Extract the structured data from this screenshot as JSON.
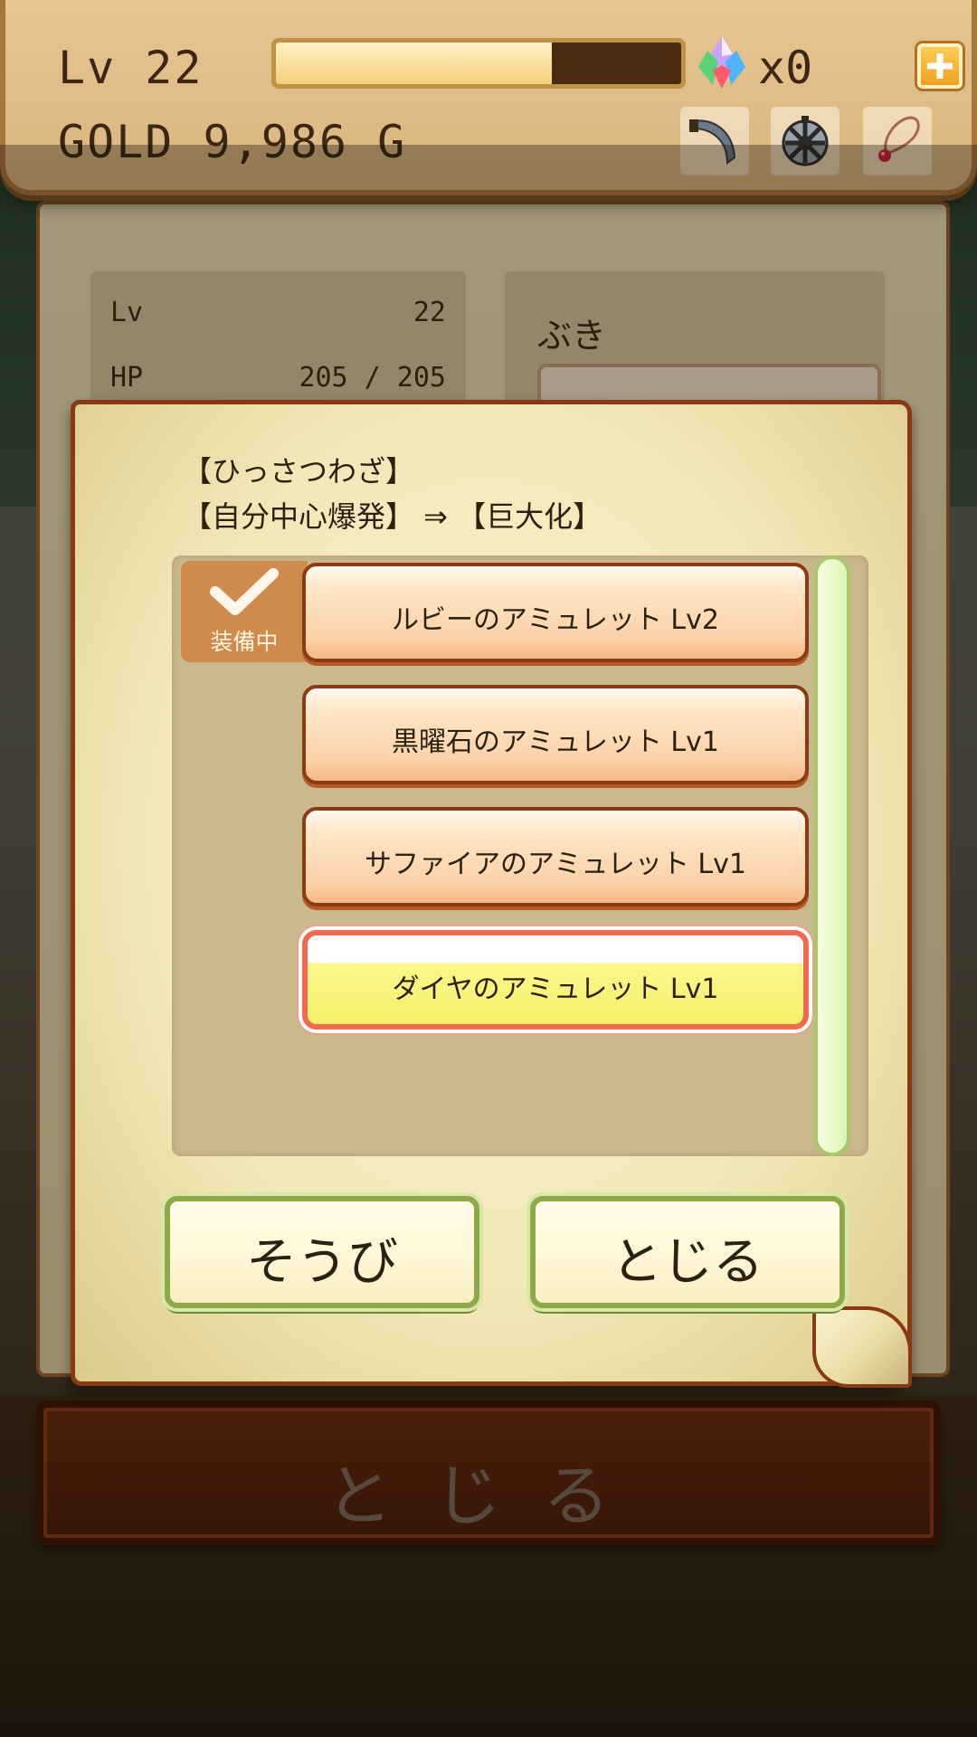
{
  "hud": {
    "level": "Lv 22",
    "gold": "GOLD 9,986 G",
    "exp_progress": 0.68,
    "gem_count": "x0"
  },
  "status": {
    "lv_label": "Lv",
    "lv_value": "22",
    "hp_label": "HP",
    "hp_value": "205 / 205",
    "weapon_label": "ぶき"
  },
  "modal": {
    "skill_title": "【ひっさつわざ】",
    "skill_change": "【自分中心爆発】 ⇒ 【巨大化】",
    "equipped_badge": "装備中",
    "amulets": [
      {
        "label": "ルビーのアミュレット Lv2",
        "equipped": true,
        "selected": false
      },
      {
        "label": "黒曜石のアミュレット Lv1",
        "equipped": false,
        "selected": false
      },
      {
        "label": "サファイアのアミュレット Lv1",
        "equipped": false,
        "selected": false
      },
      {
        "label": "ダイヤのアミュレット Lv1",
        "equipped": false,
        "selected": true
      }
    ],
    "equip_button": "そうび",
    "close_button": "とじる"
  },
  "bottom_close": "とじる",
  "colors": {
    "selected_border": "#f06a50",
    "equipped_badge": "#cf8a4c",
    "dialog_border": "#8ea84a"
  },
  "icons": [
    "gem-icon",
    "plus-icon",
    "weapon-icon",
    "shield-icon",
    "amulet-icon",
    "check-icon"
  ]
}
